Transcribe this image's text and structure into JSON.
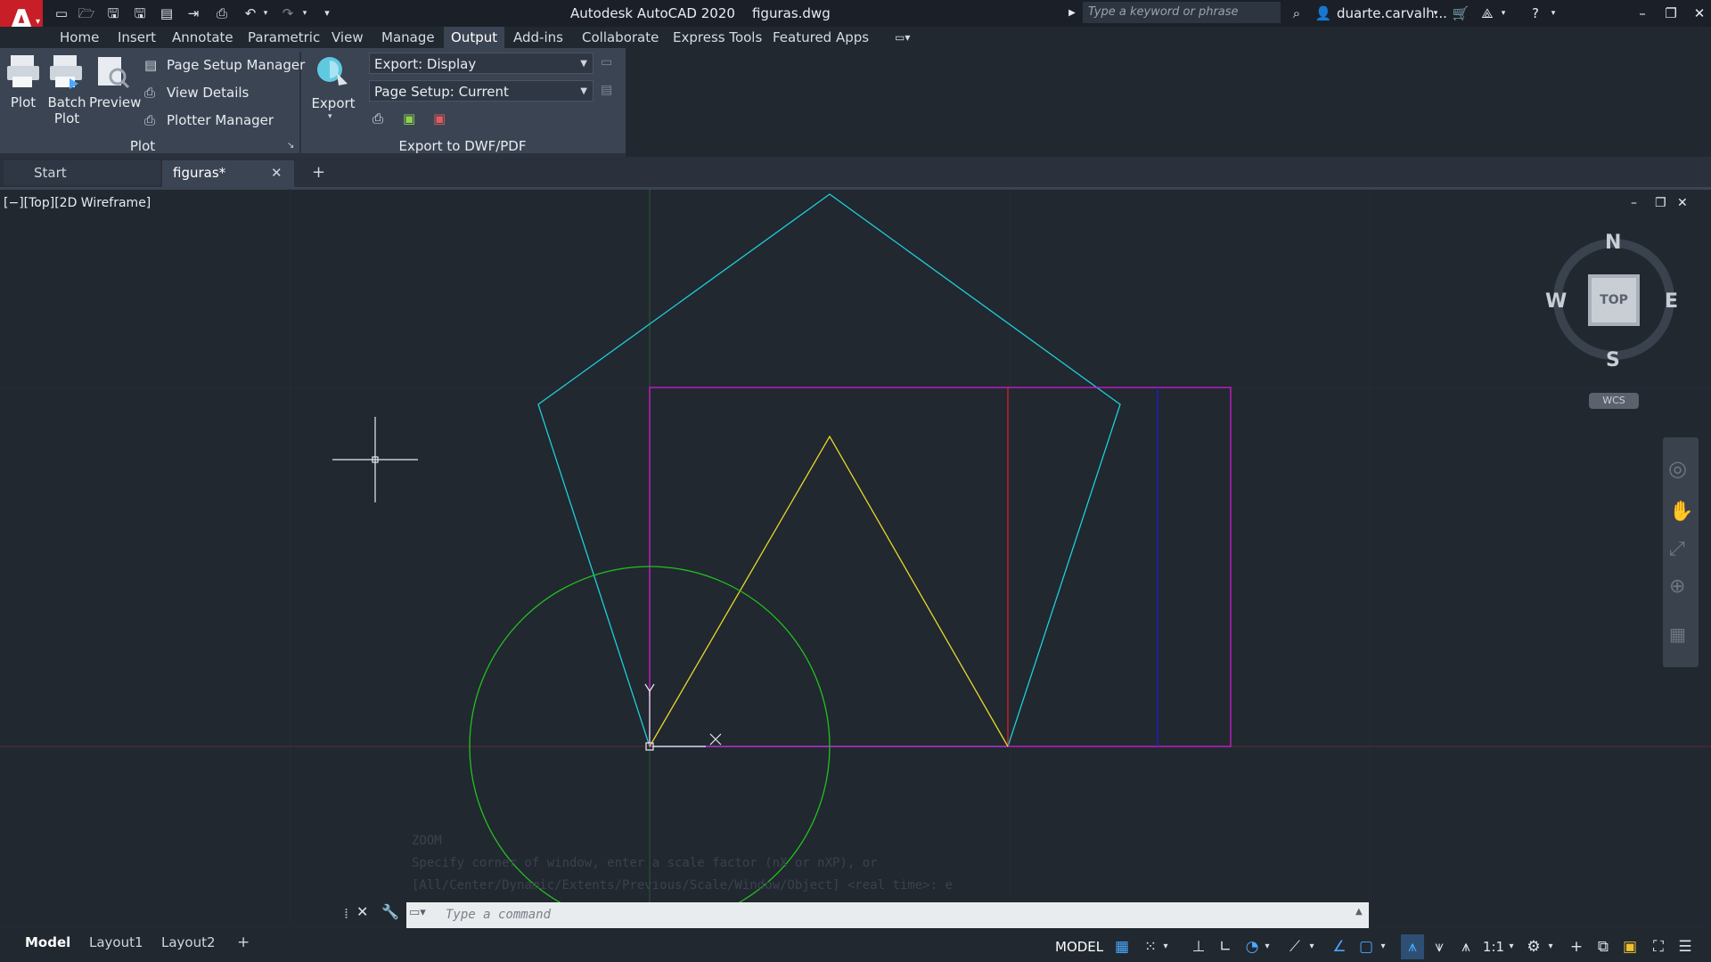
{
  "app": {
    "title": "Autodesk AutoCAD 2020",
    "file": "figuras.dwg",
    "logo": "A",
    "search_placeholder": "Type a keyword or phrase",
    "user": "duarte.carvalh..."
  },
  "ribbon_tabs": [
    "Home",
    "Insert",
    "Annotate",
    "Parametric",
    "View",
    "Manage",
    "Output",
    "Add-ins",
    "Collaborate",
    "Express Tools",
    "Featured Apps"
  ],
  "active_tab": "Output",
  "plot_panel": {
    "plot": "Plot",
    "batch_plot_1": "Batch",
    "batch_plot_2": "Plot",
    "preview": "Preview",
    "page_setup_manager": "Page Setup Manager",
    "view_details": "View Details",
    "plotter_manager": "Plotter Manager",
    "title": "Plot"
  },
  "export_panel": {
    "export": "Export",
    "export_display": "Export: Display",
    "page_setup": "Page Setup: Current",
    "title": "Export to DWF/PDF"
  },
  "doc_tabs": {
    "start": "Start",
    "active": "figuras*",
    "close": "✕",
    "add": "+"
  },
  "viewport": {
    "label": "[−][Top][2D Wireframe]"
  },
  "viewcube": {
    "n": "N",
    "s": "S",
    "e": "E",
    "w": "W",
    "face": "TOP",
    "wcs": "WCS"
  },
  "command": {
    "history": [
      "ZOOM",
      "Specify corner of window, enter a scale factor (nX or nXP), or",
      "[All/Center/Dynamic/Extents/Previous/Scale/Window/Object] <real time>: e"
    ],
    "placeholder": "Type a command"
  },
  "layout_tabs": [
    "Model",
    "Layout1",
    "Layout2"
  ],
  "status": {
    "model": "MODEL",
    "scale": "1:1"
  },
  "colors": {
    "background": "#212830",
    "ribbon": "#3b4453",
    "pentagon": "#1ecfd8",
    "rectangle": "#d21bd2",
    "triangle": "#e6d82a",
    "circle": "#22c01e",
    "red_line": "#e02020",
    "blue_line": "#2020d8"
  },
  "icons": [
    "new-icon",
    "open-icon",
    "save-icon",
    "save-as-icon",
    "plot-icon",
    "undo-icon",
    "redo-icon",
    "binoculars-icon",
    "cart-icon",
    "help-icon",
    "minimize-icon",
    "restore-icon",
    "close-icon"
  ]
}
